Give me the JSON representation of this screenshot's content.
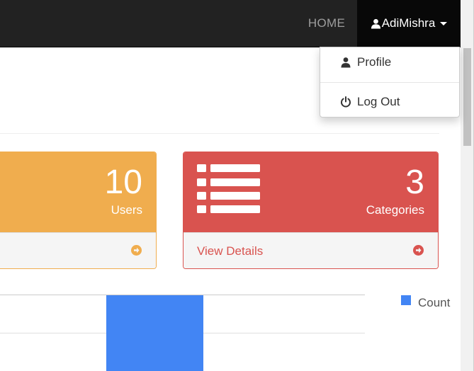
{
  "navbar": {
    "home_label": "HOME",
    "user_label": "AdiMishra"
  },
  "dropdown": {
    "items": [
      {
        "label": "Profile",
        "icon": "user-icon"
      },
      {
        "label": "Log Out",
        "icon": "power-icon"
      }
    ]
  },
  "panels": [
    {
      "value": "10",
      "label": "Users",
      "color": "#f0ad4e",
      "footer_icon": "arrow-circle-right-icon"
    },
    {
      "value": "3",
      "label": "Categories",
      "color": "#d9534f",
      "footer_label": "View Details",
      "icon": "list-icon",
      "footer_icon": "arrow-circle-right-icon"
    }
  ],
  "chart_data": {
    "type": "bar",
    "series": [
      {
        "name": "Count",
        "color": "#4285f4"
      }
    ],
    "legend": "right",
    "grid": true
  }
}
